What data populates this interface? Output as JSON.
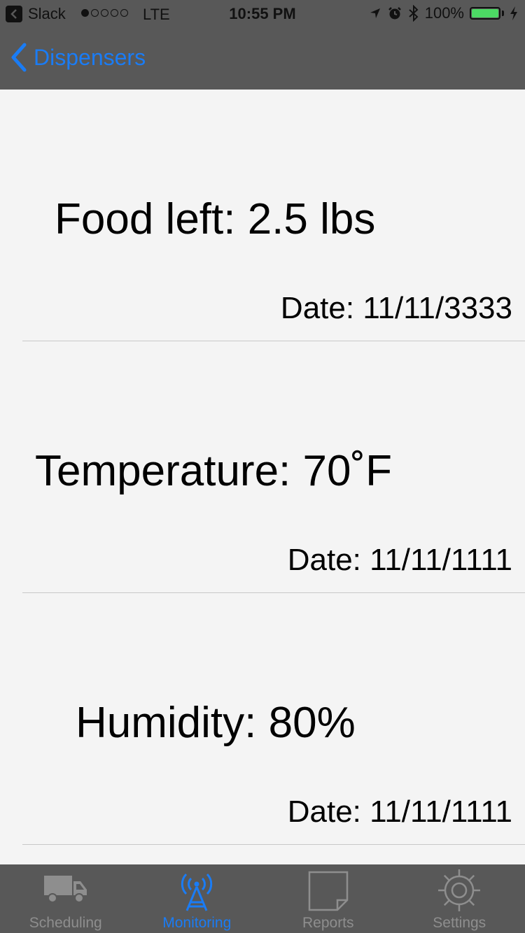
{
  "status_bar": {
    "app": "Slack",
    "carrier": "LTE",
    "time": "10:55 PM",
    "battery": "100%",
    "battery_level": 1.0,
    "signal_bars": 1
  },
  "nav": {
    "back_label": "Dispensers"
  },
  "readings": [
    {
      "value": "Food left: 2.5 lbs",
      "date": "Date: 11/11/3333"
    },
    {
      "value": "Temperature: 70˚F",
      "date": "Date: 11/11/1111"
    },
    {
      "value": "Humidity: 80%",
      "date": "Date: 11/11/1111"
    }
  ],
  "tabs": [
    {
      "label": "Scheduling",
      "icon": "truck-icon",
      "active": false
    },
    {
      "label": "Monitoring",
      "icon": "antenna-icon",
      "active": true
    },
    {
      "label": "Reports",
      "icon": "note-icon",
      "active": false
    },
    {
      "label": "Settings",
      "icon": "gear-icon",
      "active": false
    }
  ],
  "colors": {
    "accent": "#1a7cf5",
    "bar_background": "#585858",
    "content_background": "#f4f4f4",
    "inactive_tab": "#8e8e8e",
    "battery": "#4cd964"
  }
}
